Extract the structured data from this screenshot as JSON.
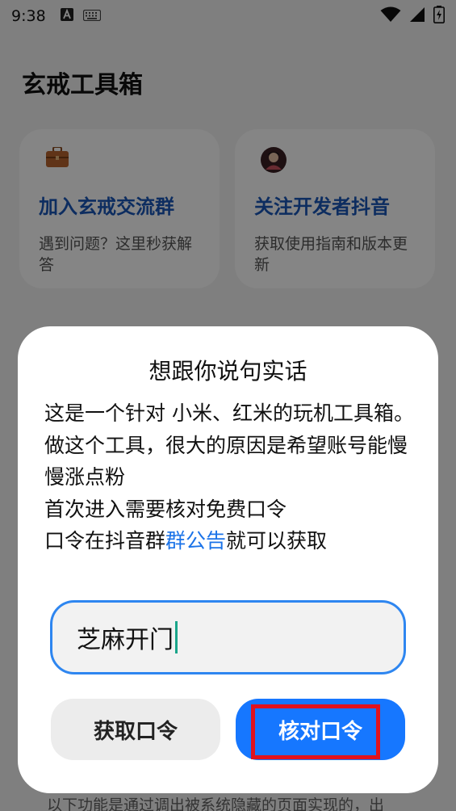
{
  "status_bar": {
    "time": "9:38"
  },
  "app": {
    "title": "玄戒工具箱"
  },
  "cards": [
    {
      "title": "加入玄戒交流群",
      "desc": "遇到问题？这里秒获解答",
      "icon": "briefcase-icon"
    },
    {
      "title": "关注开发者抖音",
      "desc": "获取使用指南和版本更新",
      "icon": "avatar-icon"
    }
  ],
  "dialog": {
    "title": "想跟你说句实话",
    "body": {
      "line1": "这是一个针对 小米、红米的玩机工具箱。",
      "line2": "做这个工具，很大的原因是希望账号能慢慢涨点粉",
      "line3": "首次进入需要核对免费口令",
      "line4_prefix": "口令在抖音群",
      "line4_link": "群公告",
      "line4_suffix": "就可以获取"
    },
    "input_value": "芝麻开门",
    "get_button": "获取口令",
    "verify_button": "核对口令"
  },
  "bottom_text": "以下功能是通过调出被系统隐藏的页面实现的，出",
  "colors": {
    "accent": "#1677ff",
    "link": "#1b73e8",
    "highlight": "#e0121e"
  }
}
